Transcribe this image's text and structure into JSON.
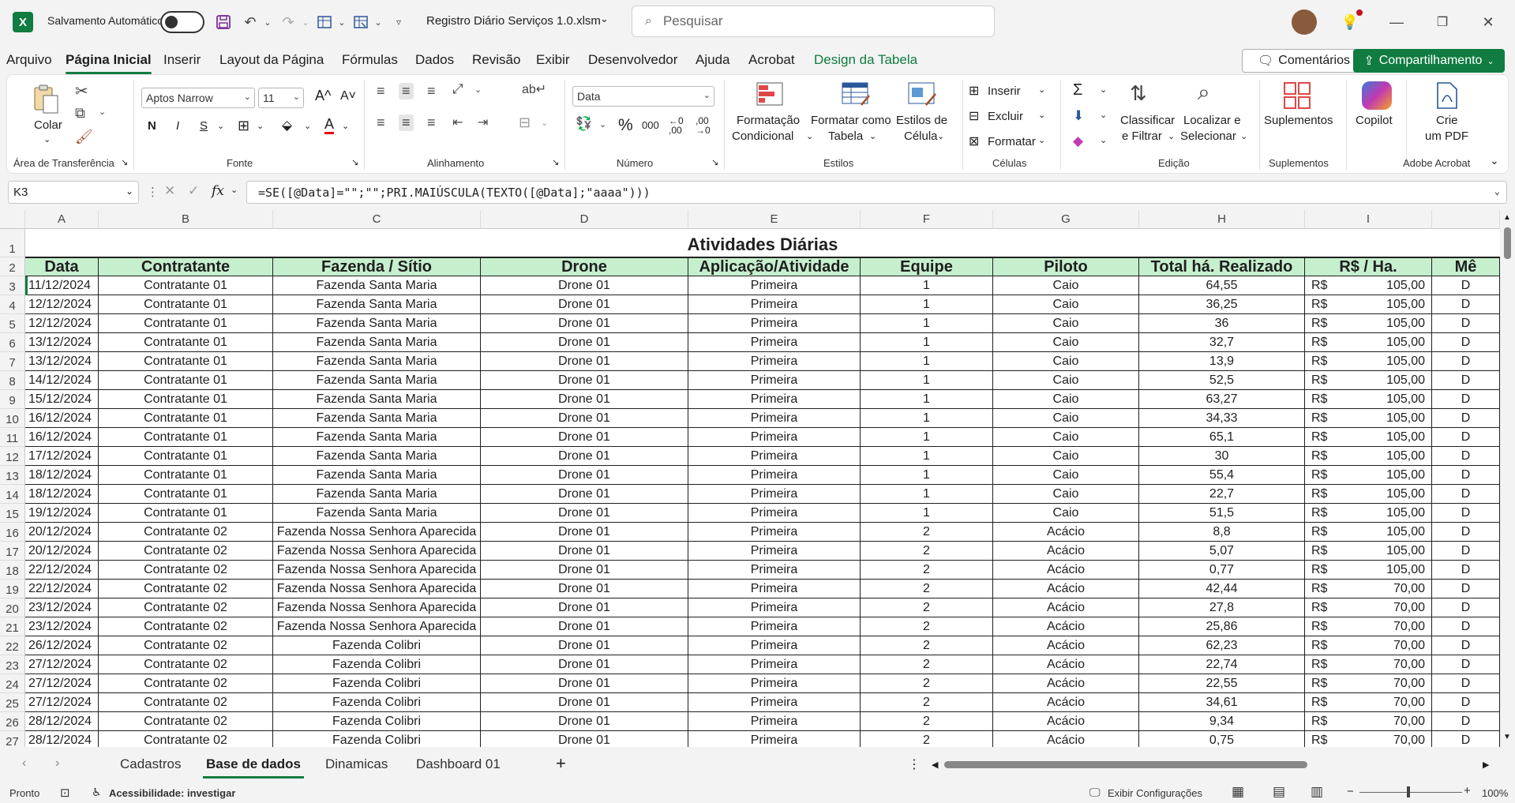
{
  "window": {
    "autosave_label": "Salvamento Automático",
    "file_title": "Registro Diário Serviços 1.0.xlsm",
    "search_placeholder": "Pesquisar"
  },
  "menu_tabs": [
    "Arquivo",
    "Página Inicial",
    "Inserir",
    "Layout da Página",
    "Fórmulas",
    "Dados",
    "Revisão",
    "Exibir",
    "Desenvolvedor",
    "Ajuda",
    "Acrobat",
    "Design da Tabela"
  ],
  "active_tab": "Página Inicial",
  "buttons": {
    "comments": "Comentários",
    "share": "Compartilhamento"
  },
  "ribbon": {
    "clipboard": {
      "paste": "Colar",
      "label": "Área de Transferência"
    },
    "font": {
      "name": "Aptos Narrow",
      "size": "11",
      "label": "Fonte"
    },
    "alignment": {
      "label": "Alinhamento"
    },
    "number": {
      "format": "Data",
      "label": "Número",
      "percent": "%",
      "thousands": "000"
    },
    "styles": {
      "conditional_1": "Formatação",
      "conditional_2": "Condicional",
      "table_1": "Formatar como",
      "table_2": "Tabela",
      "cell_1": "Estilos de",
      "cell_2": "Célula",
      "label": "Estilos"
    },
    "cells": {
      "insert": "Inserir",
      "delete": "Excluir",
      "format": "Formatar",
      "label": "Células"
    },
    "editing": {
      "sort_1": "Classificar",
      "sort_2": "e Filtrar",
      "find_1": "Localizar e",
      "find_2": "Selecionar",
      "label": "Edição"
    },
    "addins": {
      "addins": "Suplementos",
      "label": "Suplementos"
    },
    "copilot": {
      "label": "Copilot"
    },
    "acrobat": {
      "pdf_1": "Crie",
      "pdf_2": "um PDF",
      "label": "Adobe Acrobat"
    }
  },
  "formula_bar": {
    "name_box": "K3",
    "formula": "=SE([@Data]=\"\";\"\";PRI.MAIÚSCULA(TEXTO([@Data];\"aaaa\")))"
  },
  "sheet": {
    "columns": [
      "A",
      "B",
      "C",
      "D",
      "E",
      "F",
      "G",
      "H",
      "I",
      ""
    ],
    "title": "Atividades Diárias",
    "headers": [
      "Data",
      "Contratante",
      "Fazenda / Sítio",
      "Drone",
      "Aplicação/Atividade",
      "Equipe",
      "Piloto",
      "Total há. Realizado",
      "R$ / Ha.",
      "Mê"
    ],
    "rows": [
      [
        "11/12/2024",
        "Contratante 01",
        "Fazenda Santa Maria",
        "Drone 01",
        "Primeira",
        "1",
        "Caio",
        "64,55",
        "R$",
        "105,00",
        "D"
      ],
      [
        "12/12/2024",
        "Contratante 01",
        "Fazenda Santa Maria",
        "Drone 01",
        "Primeira",
        "1",
        "Caio",
        "36,25",
        "R$",
        "105,00",
        "D"
      ],
      [
        "12/12/2024",
        "Contratante 01",
        "Fazenda Santa Maria",
        "Drone 01",
        "Primeira",
        "1",
        "Caio",
        "36",
        "R$",
        "105,00",
        "D"
      ],
      [
        "13/12/2024",
        "Contratante 01",
        "Fazenda Santa Maria",
        "Drone 01",
        "Primeira",
        "1",
        "Caio",
        "32,7",
        "R$",
        "105,00",
        "D"
      ],
      [
        "13/12/2024",
        "Contratante 01",
        "Fazenda Santa Maria",
        "Drone 01",
        "Primeira",
        "1",
        "Caio",
        "13,9",
        "R$",
        "105,00",
        "D"
      ],
      [
        "14/12/2024",
        "Contratante 01",
        "Fazenda Santa Maria",
        "Drone 01",
        "Primeira",
        "1",
        "Caio",
        "52,5",
        "R$",
        "105,00",
        "D"
      ],
      [
        "15/12/2024",
        "Contratante 01",
        "Fazenda Santa Maria",
        "Drone 01",
        "Primeira",
        "1",
        "Caio",
        "63,27",
        "R$",
        "105,00",
        "D"
      ],
      [
        "16/12/2024",
        "Contratante 01",
        "Fazenda Santa Maria",
        "Drone 01",
        "Primeira",
        "1",
        "Caio",
        "34,33",
        "R$",
        "105,00",
        "D"
      ],
      [
        "16/12/2024",
        "Contratante 01",
        "Fazenda Santa Maria",
        "Drone 01",
        "Primeira",
        "1",
        "Caio",
        "65,1",
        "R$",
        "105,00",
        "D"
      ],
      [
        "17/12/2024",
        "Contratante 01",
        "Fazenda Santa Maria",
        "Drone 01",
        "Primeira",
        "1",
        "Caio",
        "30",
        "R$",
        "105,00",
        "D"
      ],
      [
        "18/12/2024",
        "Contratante 01",
        "Fazenda Santa Maria",
        "Drone 01",
        "Primeira",
        "1",
        "Caio",
        "55,4",
        "R$",
        "105,00",
        "D"
      ],
      [
        "18/12/2024",
        "Contratante 01",
        "Fazenda Santa Maria",
        "Drone 01",
        "Primeira",
        "1",
        "Caio",
        "22,7",
        "R$",
        "105,00",
        "D"
      ],
      [
        "19/12/2024",
        "Contratante 01",
        "Fazenda Santa Maria",
        "Drone 01",
        "Primeira",
        "1",
        "Caio",
        "51,5",
        "R$",
        "105,00",
        "D"
      ],
      [
        "20/12/2024",
        "Contratante 02",
        "Fazenda Nossa Senhora Aparecida",
        "Drone 01",
        "Primeira",
        "2",
        "Acácio",
        "8,8",
        "R$",
        "105,00",
        "D"
      ],
      [
        "20/12/2024",
        "Contratante 02",
        "Fazenda Nossa Senhora Aparecida",
        "Drone 01",
        "Primeira",
        "2",
        "Acácio",
        "5,07",
        "R$",
        "105,00",
        "D"
      ],
      [
        "22/12/2024",
        "Contratante 02",
        "Fazenda Nossa Senhora Aparecida",
        "Drone 01",
        "Primeira",
        "2",
        "Acácio",
        "0,77",
        "R$",
        "105,00",
        "D"
      ],
      [
        "22/12/2024",
        "Contratante 02",
        "Fazenda Nossa Senhora Aparecida",
        "Drone 01",
        "Primeira",
        "2",
        "Acácio",
        "42,44",
        "R$",
        "70,00",
        "D"
      ],
      [
        "23/12/2024",
        "Contratante 02",
        "Fazenda Nossa Senhora Aparecida",
        "Drone 01",
        "Primeira",
        "2",
        "Acácio",
        "27,8",
        "R$",
        "70,00",
        "D"
      ],
      [
        "23/12/2024",
        "Contratante 02",
        "Fazenda Nossa Senhora Aparecida",
        "Drone 01",
        "Primeira",
        "2",
        "Acácio",
        "25,86",
        "R$",
        "70,00",
        "D"
      ],
      [
        "26/12/2024",
        "Contratante 02",
        "Fazenda Colibri",
        "Drone 01",
        "Primeira",
        "2",
        "Acácio",
        "62,23",
        "R$",
        "70,00",
        "D"
      ],
      [
        "27/12/2024",
        "Contratante 02",
        "Fazenda Colibri",
        "Drone 01",
        "Primeira",
        "2",
        "Acácio",
        "22,74",
        "R$",
        "70,00",
        "D"
      ],
      [
        "27/12/2024",
        "Contratante 02",
        "Fazenda Colibri",
        "Drone 01",
        "Primeira",
        "2",
        "Acácio",
        "22,55",
        "R$",
        "70,00",
        "D"
      ],
      [
        "27/12/2024",
        "Contratante 02",
        "Fazenda Colibri",
        "Drone 01",
        "Primeira",
        "2",
        "Acácio",
        "34,61",
        "R$",
        "70,00",
        "D"
      ],
      [
        "28/12/2024",
        "Contratante 02",
        "Fazenda Colibri",
        "Drone 01",
        "Primeira",
        "2",
        "Acácio",
        "9,34",
        "R$",
        "70,00",
        "D"
      ],
      [
        "28/12/2024",
        "Contratante 02",
        "Fazenda Colibri",
        "Drone 01",
        "Primeira",
        "2",
        "Acácio",
        "0,75",
        "R$",
        "70,00",
        "D"
      ]
    ]
  },
  "sheet_tabs": [
    "Cadastros",
    "Base de dados",
    "Dinamicas",
    "Dashboard 01"
  ],
  "active_sheet": "Base de dados",
  "status_bar": {
    "ready": "Pronto",
    "accessibility": "Acessibilidade: investigar",
    "display_settings": "Exibir Configurações",
    "zoom": "100%"
  },
  "colors": {
    "excel_green": "#107c41",
    "header_fill": "#c6efce"
  }
}
